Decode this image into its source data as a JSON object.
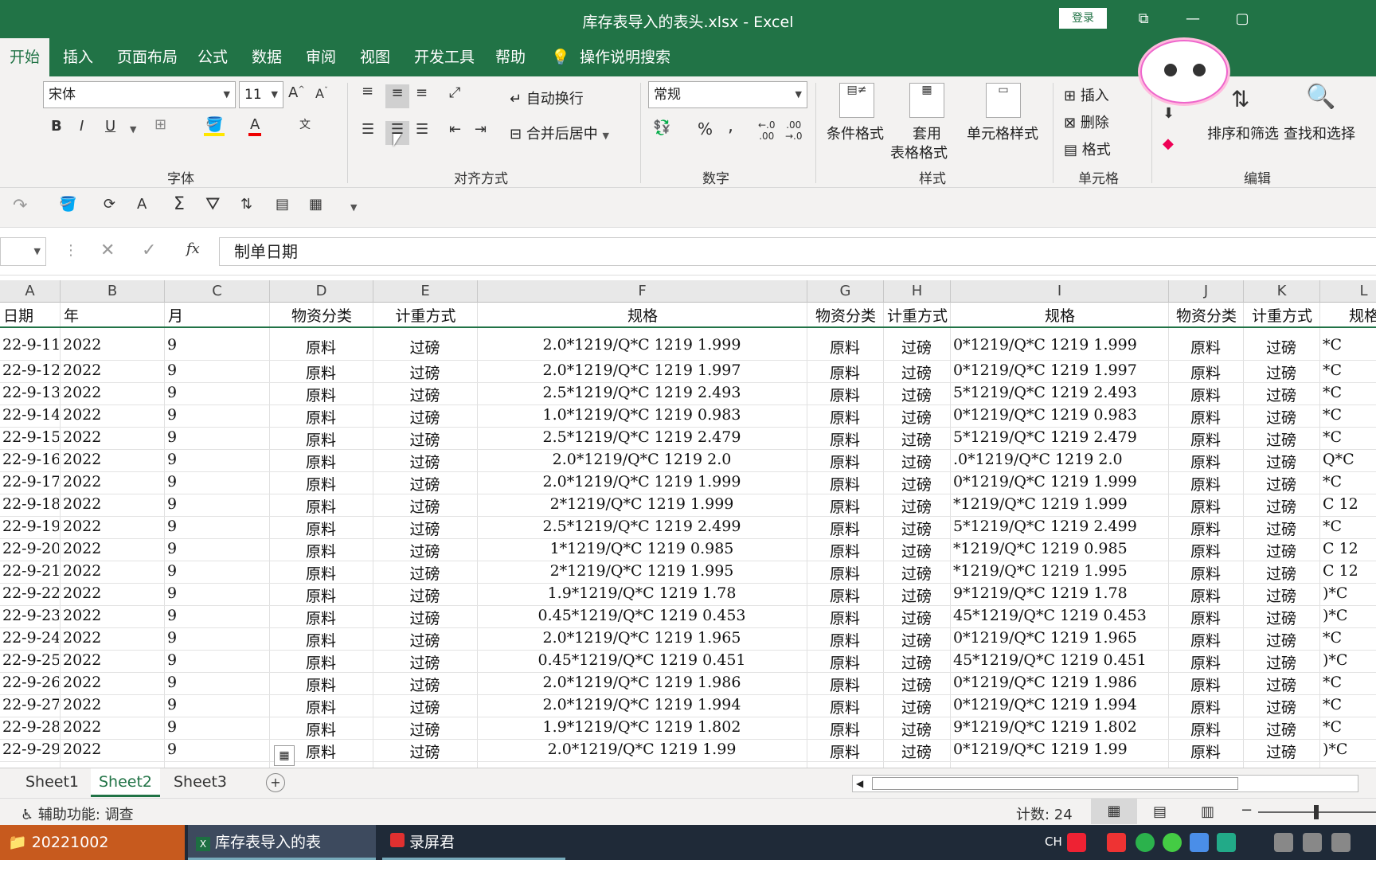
{
  "window": {
    "title": "库存表导入的表头.xlsx  -  Excel",
    "login": "登录"
  },
  "tabs": [
    "开始",
    "插入",
    "页面布局",
    "公式",
    "数据",
    "审阅",
    "视图",
    "开发工具",
    "帮助"
  ],
  "tell_me": "操作说明搜索",
  "ribbon": {
    "font": {
      "name": "宋体",
      "size": "11",
      "group": "字体"
    },
    "alignment": {
      "wrap": "自动换行",
      "merge": "合并后居中",
      "group": "对齐方式"
    },
    "number": {
      "format": "常规",
      "group": "数字",
      "percent": "%",
      "comma": ","
    },
    "styles": {
      "cond": "条件格式",
      "table1": "套用",
      "table2": "表格格式",
      "cell": "单元格样式",
      "group": "样式"
    },
    "cells": {
      "insert": "插入",
      "delete": "删除",
      "format": "格式",
      "group": "单元格"
    },
    "editing": {
      "sort": "排序和筛选",
      "find": "查找和选择",
      "group": "编辑"
    }
  },
  "formula_bar": {
    "fx": "fx",
    "value": "制单日期"
  },
  "columns": [
    {
      "letter": "A",
      "header": "日期"
    },
    {
      "letter": "B",
      "header": "年"
    },
    {
      "letter": "C",
      "header": "月"
    },
    {
      "letter": "D",
      "header": "物资分类"
    },
    {
      "letter": "E",
      "header": "计重方式"
    },
    {
      "letter": "F",
      "header": "规格"
    },
    {
      "letter": "G",
      "header": "物资分类"
    },
    {
      "letter": "H",
      "header": "计重方式"
    },
    {
      "letter": "I",
      "header": "规格"
    },
    {
      "letter": "J",
      "header": "物资分类"
    },
    {
      "letter": "K",
      "header": "计重方式"
    },
    {
      "letter": "L",
      "header": "规格"
    }
  ],
  "rows": [
    {
      "a": "22-9-11",
      "b": "2022",
      "c": "9",
      "d": "原料",
      "e": "过磅",
      "f": "2.0*1219/Q*C      1219   1.999",
      "i": "0*1219/Q*C      1219   1.999",
      "l": "*C"
    },
    {
      "a": "22-9-12",
      "b": "2022",
      "c": "9",
      "d": "原料",
      "e": "过磅",
      "f": "2.0*1219/Q*C      1219   1.997",
      "i": "0*1219/Q*C      1219   1.997",
      "l": "*C"
    },
    {
      "a": "22-9-13",
      "b": "2022",
      "c": "9",
      "d": "原料",
      "e": "过磅",
      "f": "2.5*1219/Q*C      1219   2.493",
      "i": "5*1219/Q*C      1219   2.493",
      "l": "*C"
    },
    {
      "a": "22-9-14",
      "b": "2022",
      "c": "9",
      "d": "原料",
      "e": "过磅",
      "f": "1.0*1219/Q*C      1219   0.983",
      "i": "0*1219/Q*C      1219   0.983",
      "l": "*C"
    },
    {
      "a": "22-9-15",
      "b": "2022",
      "c": "9",
      "d": "原料",
      "e": "过磅",
      "f": "2.5*1219/Q*C      1219   2.479",
      "i": "5*1219/Q*C      1219   2.479",
      "l": "*C"
    },
    {
      "a": "22-9-16",
      "b": "2022",
      "c": "9",
      "d": "原料",
      "e": "过磅",
      "f": "2.0*1219/Q*C      1219   2.0",
      "i": ".0*1219/Q*C      1219   2.0",
      "l": "Q*C"
    },
    {
      "a": "22-9-17",
      "b": "2022",
      "c": "9",
      "d": "原料",
      "e": "过磅",
      "f": "2.0*1219/Q*C      1219   1.999",
      "i": "0*1219/Q*C      1219   1.999",
      "l": "*C"
    },
    {
      "a": "22-9-18",
      "b": "2022",
      "c": "9",
      "d": "原料",
      "e": "过磅",
      "f": "2*1219/Q*C      1219   1.999",
      "i": "*1219/Q*C      1219   1.999",
      "l": "C    12"
    },
    {
      "a": "22-9-19",
      "b": "2022",
      "c": "9",
      "d": "原料",
      "e": "过磅",
      "f": "2.5*1219/Q*C      1219   2.499",
      "i": "5*1219/Q*C      1219   2.499",
      "l": "*C"
    },
    {
      "a": "22-9-20",
      "b": "2022",
      "c": "9",
      "d": "原料",
      "e": "过磅",
      "f": "1*1219/Q*C      1219   0.985",
      "i": "*1219/Q*C      1219   0.985",
      "l": "C    12"
    },
    {
      "a": "22-9-21",
      "b": "2022",
      "c": "9",
      "d": "原料",
      "e": "过磅",
      "f": "2*1219/Q*C      1219   1.995",
      "i": "*1219/Q*C      1219   1.995",
      "l": "C    12"
    },
    {
      "a": "22-9-22",
      "b": "2022",
      "c": "9",
      "d": "原料",
      "e": "过磅",
      "f": "1.9*1219/Q*C      1219   1.78",
      "i": "9*1219/Q*C      1219   1.78",
      "l": ")*C"
    },
    {
      "a": "22-9-23",
      "b": "2022",
      "c": "9",
      "d": "原料",
      "e": "过磅",
      "f": "0.45*1219/Q*C      1219   0.453",
      "i": "45*1219/Q*C      1219   0.453",
      "l": ")*C"
    },
    {
      "a": "22-9-24",
      "b": "2022",
      "c": "9",
      "d": "原料",
      "e": "过磅",
      "f": "2.0*1219/Q*C      1219   1.965",
      "i": "0*1219/Q*C      1219   1.965",
      "l": "*C"
    },
    {
      "a": "22-9-25",
      "b": "2022",
      "c": "9",
      "d": "原料",
      "e": "过磅",
      "f": "0.45*1219/Q*C      1219   0.451",
      "i": "45*1219/Q*C      1219   0.451",
      "l": ")*C"
    },
    {
      "a": "22-9-26",
      "b": "2022",
      "c": "9",
      "d": "原料",
      "e": "过磅",
      "f": "2.0*1219/Q*C      1219   1.986",
      "i": "0*1219/Q*C      1219   1.986",
      "l": "*C"
    },
    {
      "a": "22-9-27",
      "b": "2022",
      "c": "9",
      "d": "原料",
      "e": "过磅",
      "f": "2.0*1219/Q*C      1219   1.994",
      "i": "0*1219/Q*C      1219   1.994",
      "l": "*C"
    },
    {
      "a": "22-9-28",
      "b": "2022",
      "c": "9",
      "d": "原料",
      "e": "过磅",
      "f": "1.9*1219/Q*C      1219   1.802",
      "i": "9*1219/Q*C      1219   1.802",
      "l": "*C"
    },
    {
      "a": "22-9-29",
      "b": "2022",
      "c": "9",
      "d": "原料",
      "e": "过磅",
      "f": "2.0*1219/Q*C      1219   1.99",
      "i": "0*1219/Q*C      1219   1.99",
      "l": ")*C"
    }
  ],
  "sheets": [
    "Sheet1",
    "Sheet2",
    "Sheet3"
  ],
  "active_sheet": "Sheet2",
  "status": {
    "accessibility": "辅助功能: 调查",
    "count": "计数: 24"
  },
  "taskbar": {
    "folder": "20221002",
    "excel": "库存表导入的表头.xls...",
    "recorder": "录屏君",
    "ime": "CH"
  },
  "colors": {
    "excel_green": "#217346",
    "ribbon_bg": "#f3f2f1",
    "taskbar": "#1f2a38"
  }
}
